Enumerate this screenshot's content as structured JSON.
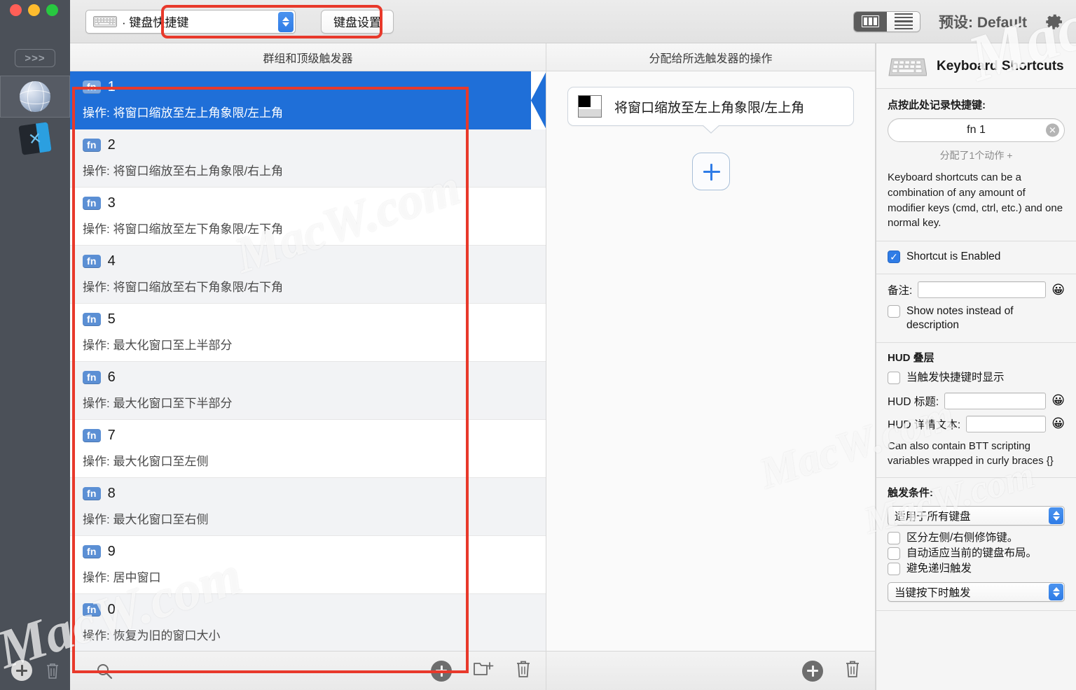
{
  "window": {
    "traffic_lights": [
      "close",
      "minimize",
      "zoom"
    ]
  },
  "toolbar": {
    "popup_icon": "keyboard-icon",
    "popup_value": "· 键盘快捷键",
    "keyboard_settings_button": "键盘设置",
    "view_mode_columns": "columns-view-icon",
    "view_mode_list": "list-view-icon",
    "preset_label": "预设: Default",
    "gear": "gear-icon"
  },
  "rail": {
    "expand_label": ">>>",
    "apps": [
      {
        "name": "globe-app-icon",
        "selected": true
      },
      {
        "name": "vscode-app-icon",
        "selected": false
      }
    ],
    "add_button": "add-app-button",
    "delete_button": "delete-app-button"
  },
  "triggers_column": {
    "header": "群组和顶级触发器",
    "rows": [
      {
        "key": "fn",
        "name": "1",
        "action": "操作: 将窗口缩放至左上角象限/左上角",
        "selected": true
      },
      {
        "key": "fn",
        "name": "2",
        "action": "操作: 将窗口缩放至右上角象限/右上角",
        "selected": false
      },
      {
        "key": "fn",
        "name": "3",
        "action": "操作: 将窗口缩放至左下角象限/左下角",
        "selected": false
      },
      {
        "key": "fn",
        "name": "4",
        "action": "操作: 将窗口缩放至右下角象限/右下角",
        "selected": false
      },
      {
        "key": "fn",
        "name": "5",
        "action": "操作: 最大化窗口至上半部分",
        "selected": false
      },
      {
        "key": "fn",
        "name": "6",
        "action": "操作: 最大化窗口至下半部分",
        "selected": false
      },
      {
        "key": "fn",
        "name": "7",
        "action": "操作: 最大化窗口至左侧",
        "selected": false
      },
      {
        "key": "fn",
        "name": "8",
        "action": "操作: 最大化窗口至右侧",
        "selected": false
      },
      {
        "key": "fn",
        "name": "9",
        "action": "操作: 居中窗口",
        "selected": false
      },
      {
        "key": "fn",
        "name": "0",
        "action": "操作: 恢复为旧的窗口大小",
        "selected": false
      }
    ],
    "footer": {
      "search_icon": "search-icon",
      "add_trigger": "add-trigger-button",
      "new_group": "new-group-button",
      "delete_trigger": "delete-trigger-button"
    }
  },
  "actions_column": {
    "header": "分配给所选触发器的操作",
    "action_card": {
      "thumbnail": "window-top-left-quadrant-icon",
      "label": "将窗口缩放至左上角象限/左上角"
    },
    "add_action_node": "add-action-button",
    "footer": {
      "add_action": "add-action-button",
      "delete_action": "delete-action-button"
    }
  },
  "inspector": {
    "icon": "keyboard-icon",
    "title": "Keyboard Shortcuts",
    "record_section": {
      "label": "点按此处记录快捷键:",
      "value": "fn 1",
      "clear": "✕",
      "assigned": "分配了1个动作 +",
      "description": "Keyboard shortcuts can be a combination of any amount of modifier keys (cmd, ctrl, etc.) and one normal key."
    },
    "enabled_checkbox": {
      "label": "Shortcut is Enabled",
      "checked": true
    },
    "notes": {
      "label": "备注:",
      "value": "",
      "emoji": "😀",
      "show_notes_checkbox": {
        "label": "Show notes instead of description",
        "checked": false
      }
    },
    "hud": {
      "title": "HUD 叠层",
      "show_checkbox": {
        "label": "当触发快捷键时显示",
        "checked": false
      },
      "hud_title_label": "HUD 标题:",
      "hud_title_value": "",
      "hud_detail_label": "HUD 详情文本:",
      "hud_detail_value": "",
      "emoji": "😀",
      "hint": "Can also contain BTT scripting variables wrapped in curly braces {}"
    },
    "conditions": {
      "label": "触发条件:",
      "select_value": "适用于所有键盘",
      "checkboxes": [
        {
          "label": "区分左侧/右侧修饰键。",
          "checked": false
        },
        {
          "label": "自动适应当前的键盘布局。",
          "checked": false
        },
        {
          "label": "避免递归触发",
          "checked": false
        }
      ],
      "bottom_select_value": "当键按下时触发"
    }
  },
  "watermarks": [
    "MacW.com",
    "MacW.com",
    "MacW.com",
    "MacW.com",
    "MacW.com"
  ],
  "colors": {
    "selection_blue": "#1f6fd8",
    "accent_blue": "#2f7ce6",
    "highlight_red": "#e8392b",
    "rail_dark": "#4b5058"
  }
}
